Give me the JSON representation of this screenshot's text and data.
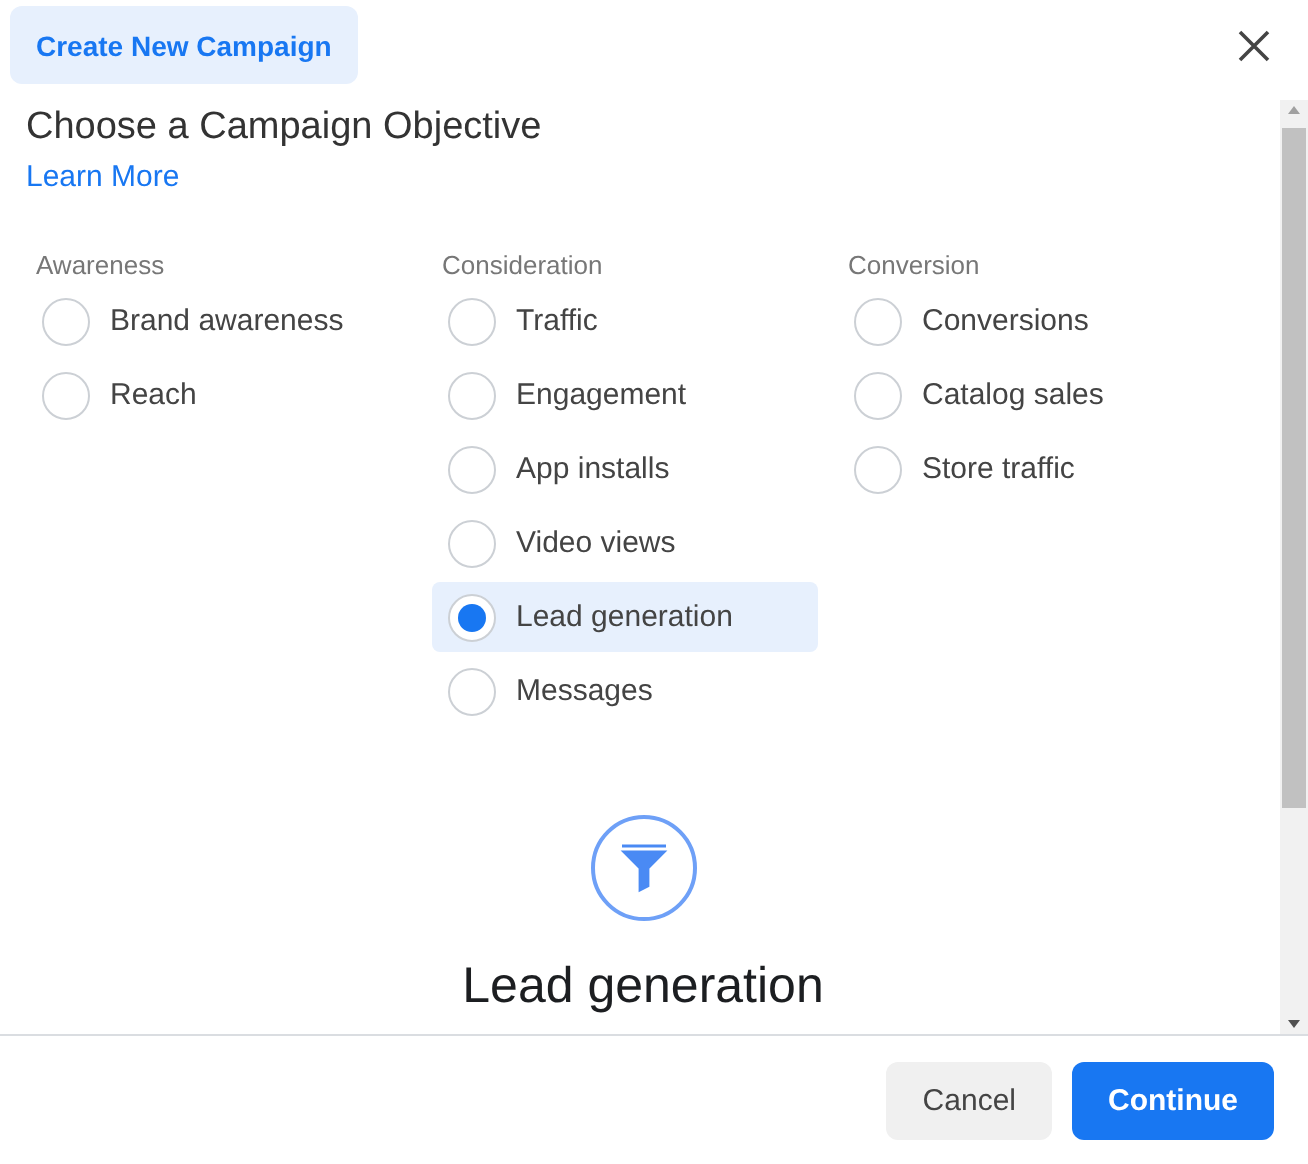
{
  "header": {
    "tab": "Create New Campaign"
  },
  "title": "Choose a Campaign Objective",
  "learn_more": "Learn More",
  "columns": [
    {
      "heading": "Awareness",
      "options": [
        {
          "label": "Brand awareness",
          "selected": false
        },
        {
          "label": "Reach",
          "selected": false
        }
      ]
    },
    {
      "heading": "Consideration",
      "options": [
        {
          "label": "Traffic",
          "selected": false
        },
        {
          "label": "Engagement",
          "selected": false
        },
        {
          "label": "App installs",
          "selected": false
        },
        {
          "label": "Video views",
          "selected": false
        },
        {
          "label": "Lead generation",
          "selected": true
        },
        {
          "label": "Messages",
          "selected": false
        }
      ]
    },
    {
      "heading": "Conversion",
      "options": [
        {
          "label": "Conversions",
          "selected": false
        },
        {
          "label": "Catalog sales",
          "selected": false
        },
        {
          "label": "Store traffic",
          "selected": false
        }
      ]
    }
  ],
  "detail": {
    "title": "Lead generation"
  },
  "buttons": [
    {
      "label": "Cancel",
      "kind": "secondary"
    },
    {
      "label": "Continue",
      "kind": "primary"
    }
  ]
}
